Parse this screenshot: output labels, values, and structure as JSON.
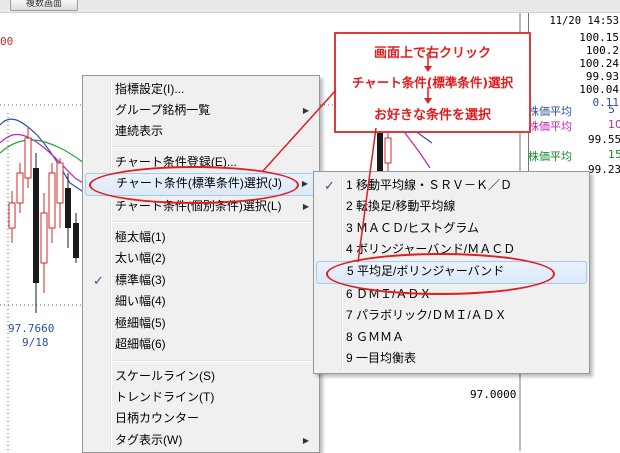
{
  "topbar": {
    "button_label": "複数画面"
  },
  "chart": {
    "price_left_top": "00",
    "low_value": "97.7660",
    "low_date": "9/18",
    "scale_label": "97.0000"
  },
  "info_panel": {
    "datetime": "11/20 14:53",
    "values": [
      "100.15",
      "100.2",
      "100.24",
      "99.93",
      "100.04",
      "0.11"
    ]
  },
  "indicators": [
    {
      "label": "株価平均",
      "value": "5",
      "color": "#2a4fa8"
    },
    {
      "label": "株価平均",
      "value": "10",
      "color": "#c023b8"
    },
    {
      "label": "",
      "value": "99.55",
      "color": "#000000"
    },
    {
      "label": "株価平均",
      "value": "15",
      "color": "#0f8a2a"
    },
    {
      "label": "",
      "value": "99.23",
      "color": "#000000"
    }
  ],
  "callout": {
    "line1": "画面上で右クリック",
    "line2": "チャート条件(標準条件)選択",
    "line3": "お好きな条件を選択"
  },
  "context_menu": {
    "items": [
      {
        "label": "指標設定(I)...",
        "arrow": false
      },
      {
        "label": "グループ銘柄一覧",
        "arrow": true
      },
      {
        "label": "連続表示",
        "arrow": false
      },
      {
        "label": "チャート条件登録(E)...",
        "arrow": false
      },
      {
        "label": "チャート条件(標準条件)選択(J)",
        "arrow": true
      },
      {
        "label": "チャート条件(個別条件)選択(L)",
        "arrow": true
      },
      {
        "label": "極太幅(1)",
        "arrow": false
      },
      {
        "label": "太い幅(2)",
        "arrow": false
      },
      {
        "label": "標準幅(3)",
        "arrow": false,
        "checked": true
      },
      {
        "label": "細い幅(4)",
        "arrow": false
      },
      {
        "label": "極細幅(5)",
        "arrow": false
      },
      {
        "label": "超細幅(6)",
        "arrow": false
      },
      {
        "label": "スケールライン(S)",
        "arrow": false
      },
      {
        "label": "トレンドライン(T)",
        "arrow": false
      },
      {
        "label": "日柄カウンター",
        "arrow": false
      },
      {
        "label": "タグ表示(W)",
        "arrow": true
      }
    ],
    "arrow_glyph": "▶",
    "check_glyph": "✓"
  },
  "submenu": {
    "items": [
      {
        "label": "1 移動平均線・ＳＲＶ－Ｋ／Ｄ",
        "checked": true
      },
      {
        "label": "2 転換足/移動平均線"
      },
      {
        "label": "3 ＭＡＣＤ/ヒストグラム"
      },
      {
        "label": "4 ボリンジャーバンド/ＭＡＣＤ"
      },
      {
        "label": "5 平均足/ボリンジャーバンド",
        "highlighted": true
      },
      {
        "label": "6 ＤＭＩ/ＡＤＸ"
      },
      {
        "label": "7 パラボリック/ＤＭＩ/ＡＤＸ"
      },
      {
        "label": "8 ＧＭＭＡ"
      },
      {
        "label": "9 一目均衡表"
      }
    ]
  },
  "colors": {
    "accent_red": "#e01e1e",
    "menu_bg": "#f0f0f0",
    "highlight": "#dce9f8",
    "candle_red": "#d0282b",
    "candle_black": "#1a1a1a"
  }
}
